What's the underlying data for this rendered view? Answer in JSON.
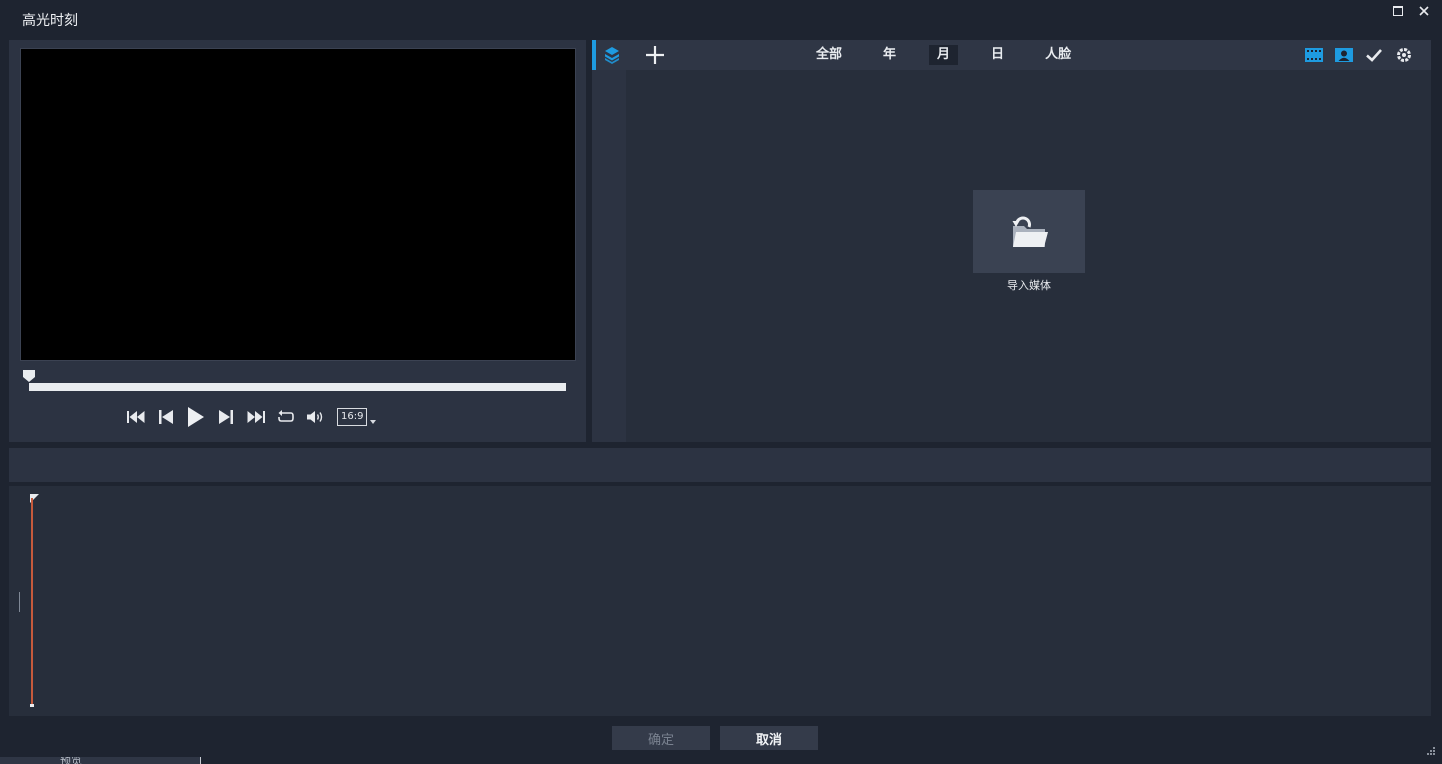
{
  "window": {
    "title": "高光时刻",
    "maximize_icon": "maximize-icon",
    "close_icon": "close-icon"
  },
  "preview": {
    "progress": 0,
    "controls": [
      "skip-to-start-icon",
      "previous-frame-icon",
      "play-icon",
      "next-frame-icon",
      "skip-to-end-icon",
      "repeat-icon",
      "volume-icon"
    ],
    "aspect_ratio": "16:9"
  },
  "library": {
    "filters": [
      {
        "label": "全部",
        "active": false
      },
      {
        "label": "年",
        "active": false
      },
      {
        "label": "月",
        "active": true
      },
      {
        "label": "日",
        "active": false
      },
      {
        "label": "人脸",
        "active": false
      }
    ],
    "right_icons": [
      "film-strip-icon",
      "face-card-icon",
      "checkmark-icon",
      "settings-icon"
    ],
    "import_label": "导入媒体",
    "accent_color": "#1e9be0"
  },
  "footer": {
    "ok_label": "确定",
    "cancel_label": "取消"
  },
  "underlying_text": "预览"
}
